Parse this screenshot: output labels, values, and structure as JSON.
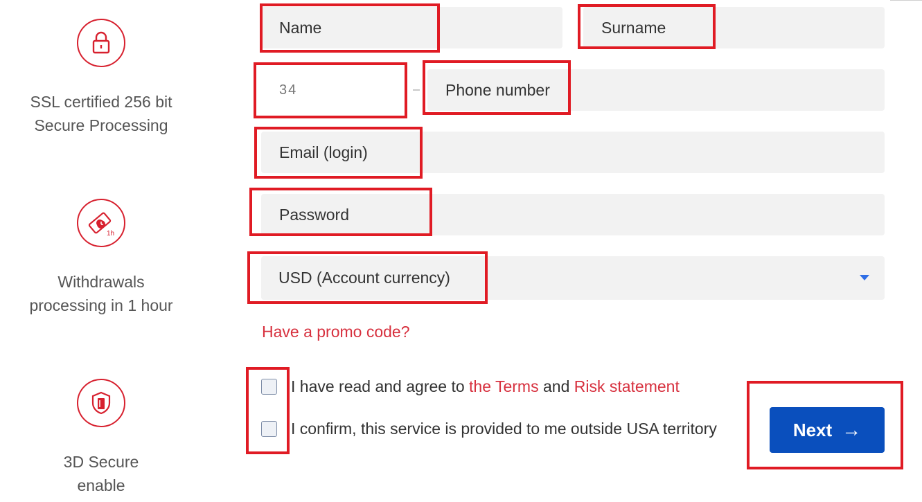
{
  "features": [
    {
      "icon": "lock-icon",
      "line1": "SSL certified 256 bit",
      "line2": "Secure Processing"
    },
    {
      "icon": "money-clock-icon",
      "line1": "Withdrawals",
      "line2": "processing in 1 hour"
    },
    {
      "icon": "shield-card-icon",
      "line1": "3D Secure",
      "line2": "enable"
    }
  ],
  "form": {
    "name_placeholder": "Name",
    "surname_placeholder": "Surname",
    "country_code": "34",
    "phone_placeholder": "Phone number",
    "email_placeholder": "Email (login)",
    "password_placeholder": "Password",
    "currency_selected": "USD (Account currency)",
    "promo_link": "Have a promo code?",
    "agree_prefix": "I have read and agree to ",
    "terms_link": "the Terms",
    "agree_and": " and ",
    "risk_link": "Risk statement",
    "confirm_text": "I confirm, this service is provided to me outside USA territory",
    "next_label": "Next",
    "next_arrow": "→"
  },
  "colors": {
    "accent_red": "#d7202e",
    "button_blue": "#0a4fbd",
    "annotation_red": "#e01b24",
    "field_bg": "#f2f2f2"
  }
}
